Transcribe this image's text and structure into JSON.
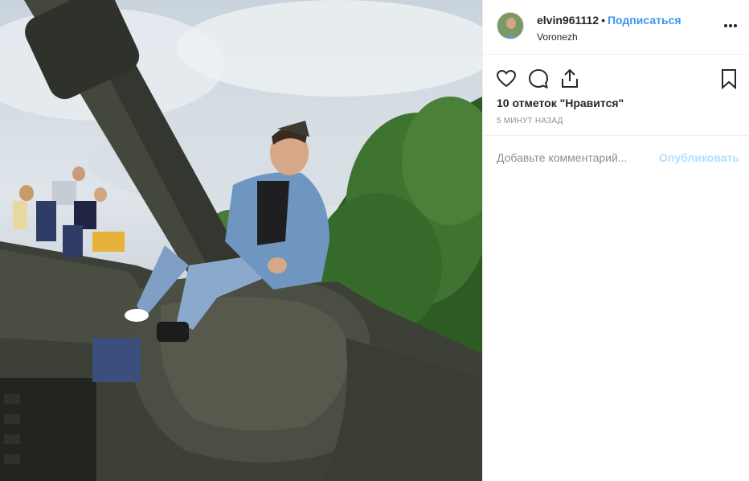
{
  "post": {
    "photo_alt": "photo-tank",
    "author": {
      "username": "elvin961112",
      "separator": "•",
      "follow_label": "Подписаться",
      "location": "Voronezh"
    },
    "likes_text": "10 отметок \"Нравится\"",
    "time_ago": "5 минут назад",
    "comment": {
      "placeholder": "Добавьте комментарий...",
      "publish_label": "Опубликовать"
    },
    "icons": {
      "like": "heart-icon",
      "comment": "comment-bubble-icon",
      "share": "share-icon",
      "save": "bookmark-icon",
      "more": "more-dots-icon"
    }
  },
  "colors": {
    "accent": "#3897f0",
    "publish_disabled": "#b2dffc",
    "muted": "#8e8e8e",
    "text": "#262626",
    "divider": "#efefef"
  }
}
